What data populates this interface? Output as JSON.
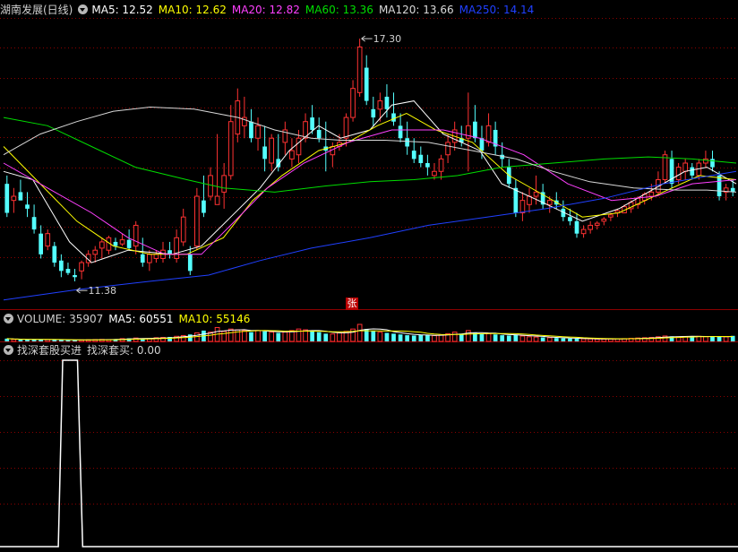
{
  "main_header": {
    "stock_name": "湖南发展(日线)",
    "ma_labels": [
      {
        "text": "MA5: 12.52",
        "color": "#ffffff"
      },
      {
        "text": "MA10: 12.62",
        "color": "#ffff00"
      },
      {
        "text": "MA20: 12.82",
        "color": "#ff40ff"
      },
      {
        "text": "MA60: 13.36",
        "color": "#00dd00"
      },
      {
        "text": "MA120: 13.66",
        "color": "#d8d8d8"
      },
      {
        "text": "MA250: 14.14",
        "color": "#2040ff"
      }
    ]
  },
  "volume_header": {
    "volume_label": "VOLUME: 35907",
    "ma5_label": "MA5: 60551",
    "ma10_label": "MA10: 55146"
  },
  "indicator_header": {
    "name": "找深套股买进",
    "value_label": "找深套买: 0.00"
  },
  "badge": "张",
  "chart_data": {
    "type": "candlestick",
    "price_range": [
      10.8,
      17.8
    ],
    "annotations": [
      {
        "text": "17.30",
        "value": 17.3
      },
      {
        "text": "11.38",
        "value": 11.38
      }
    ],
    "colors": {
      "up": "#ff3232",
      "down": "#54ffff",
      "ma5": "#ffffff",
      "ma10": "#ffff00",
      "ma20": "#ff40ff",
      "ma60": "#00dd00",
      "ma120": "#d8d8d8",
      "ma250": "#2040ff",
      "indicator": "#ffffff",
      "grid": "#8b0000"
    },
    "candles": [
      [
        13.8,
        14.0,
        13.0,
        13.1
      ],
      [
        13.4,
        13.7,
        13.1,
        13.5
      ],
      [
        13.6,
        13.9,
        13.4,
        13.4
      ],
      [
        13.3,
        13.6,
        13.0,
        13.2
      ],
      [
        13.0,
        13.3,
        12.6,
        12.7
      ],
      [
        12.6,
        12.8,
        12.0,
        12.1
      ],
      [
        12.3,
        12.7,
        12.2,
        12.6
      ],
      [
        12.3,
        12.4,
        11.8,
        11.9
      ],
      [
        11.95,
        12.1,
        11.55,
        11.7
      ],
      [
        11.75,
        11.9,
        11.6,
        11.65
      ],
      [
        11.6,
        11.75,
        11.45,
        11.55
      ],
      [
        11.7,
        11.95,
        11.5,
        11.9
      ],
      [
        11.9,
        12.2,
        11.8,
        12.1
      ],
      [
        12.1,
        12.3,
        11.9,
        12.2
      ],
      [
        12.25,
        12.5,
        12.0,
        12.4
      ],
      [
        12.2,
        12.55,
        12.1,
        12.5
      ],
      [
        12.4,
        12.5,
        12.2,
        12.3
      ],
      [
        12.35,
        12.6,
        12.3,
        12.45
      ],
      [
        12.45,
        12.7,
        12.2,
        12.25
      ],
      [
        12.3,
        12.9,
        12.1,
        12.8
      ],
      [
        12.1,
        12.5,
        11.8,
        11.9
      ],
      [
        11.9,
        12.2,
        11.7,
        12.1
      ],
      [
        12.0,
        12.2,
        11.9,
        12.1
      ],
      [
        12.0,
        12.4,
        11.9,
        12.2
      ],
      [
        12.2,
        12.4,
        12.0,
        12.1
      ],
      [
        12.0,
        12.7,
        11.9,
        12.5
      ],
      [
        12.4,
        13.2,
        12.3,
        13.0
      ],
      [
        12.1,
        12.3,
        11.6,
        11.7
      ],
      [
        12.3,
        13.7,
        12.2,
        13.5
      ],
      [
        13.4,
        14.0,
        13.0,
        13.1
      ],
      [
        13.5,
        14.2,
        13.4,
        14.0
      ],
      [
        13.3,
        15.0,
        13.3,
        13.5
      ],
      [
        13.6,
        14.3,
        13.2,
        14.0
      ],
      [
        14.0,
        15.7,
        13.9,
        15.3
      ],
      [
        15.0,
        16.1,
        14.8,
        15.8
      ],
      [
        15.2,
        15.9,
        14.9,
        15.4
      ],
      [
        15.3,
        15.6,
        14.8,
        14.9
      ],
      [
        14.9,
        15.4,
        14.6,
        15.2
      ],
      [
        14.7,
        15.2,
        14.1,
        14.4
      ],
      [
        14.3,
        15.0,
        14.1,
        14.9
      ],
      [
        14.4,
        15.0,
        14.1,
        14.2
      ],
      [
        14.8,
        15.3,
        14.5,
        15.1
      ],
      [
        14.4,
        14.9,
        14.2,
        14.6
      ],
      [
        14.5,
        15.1,
        14.3,
        14.9
      ],
      [
        14.9,
        15.5,
        14.8,
        15.3
      ],
      [
        15.4,
        15.7,
        15.0,
        15.1
      ],
      [
        15.1,
        15.4,
        14.8,
        14.9
      ],
      [
        14.7,
        15.3,
        14.1,
        14.6
      ],
      [
        14.5,
        14.8,
        14.2,
        14.7
      ],
      [
        14.7,
        15.0,
        14.6,
        14.8
      ],
      [
        14.9,
        15.5,
        14.7,
        15.4
      ],
      [
        15.4,
        16.3,
        15.3,
        16.1
      ],
      [
        16.0,
        17.3,
        15.9,
        17.1
      ],
      [
        16.6,
        16.9,
        15.7,
        15.8
      ],
      [
        15.6,
        15.9,
        15.2,
        15.4
      ],
      [
        15.6,
        16.0,
        15.3,
        15.8
      ],
      [
        15.9,
        16.2,
        15.4,
        15.6
      ],
      [
        15.5,
        16.0,
        15.2,
        15.3
      ],
      [
        15.2,
        15.5,
        14.8,
        14.9
      ],
      [
        14.9,
        15.3,
        14.5,
        14.7
      ],
      [
        14.6,
        14.9,
        14.3,
        14.4
      ],
      [
        14.5,
        14.7,
        14.2,
        14.3
      ],
      [
        14.3,
        14.5,
        14.0,
        14.2
      ],
      [
        14.0,
        14.3,
        13.9,
        14.1
      ],
      [
        14.1,
        14.5,
        13.9,
        14.4
      ],
      [
        14.5,
        15.0,
        14.3,
        14.8
      ],
      [
        14.8,
        15.3,
        14.6,
        15.1
      ],
      [
        14.9,
        15.2,
        14.7,
        14.8
      ],
      [
        14.9,
        16.0,
        14.1,
        15.2
      ],
      [
        15.3,
        15.7,
        14.8,
        14.9
      ],
      [
        14.9,
        15.2,
        14.4,
        14.6
      ],
      [
        14.8,
        15.5,
        14.7,
        15.2
      ],
      [
        15.1,
        15.3,
        14.5,
        14.7
      ],
      [
        14.5,
        14.8,
        14.2,
        14.4
      ],
      [
        14.2,
        14.4,
        13.7,
        13.8
      ],
      [
        13.7,
        13.9,
        13.0,
        13.1
      ],
      [
        13.1,
        13.6,
        12.9,
        13.4
      ],
      [
        13.3,
        13.7,
        13.1,
        13.5
      ],
      [
        13.5,
        14.0,
        13.3,
        13.6
      ],
      [
        13.6,
        13.8,
        13.2,
        13.3
      ],
      [
        13.3,
        13.5,
        13.1,
        13.4
      ],
      [
        13.4,
        13.6,
        13.2,
        13.3
      ],
      [
        13.2,
        13.4,
        12.9,
        13.0
      ],
      [
        13.0,
        13.2,
        12.8,
        12.9
      ],
      [
        12.9,
        13.1,
        12.5,
        12.6
      ],
      [
        12.6,
        12.8,
        12.5,
        12.7
      ],
      [
        12.7,
        12.9,
        12.6,
        12.8
      ],
      [
        12.8,
        12.9,
        12.7,
        12.85
      ],
      [
        12.9,
        13.0,
        12.8,
        12.95
      ],
      [
        13.0,
        13.1,
        12.9,
        13.05
      ],
      [
        13.1,
        13.2,
        13.0,
        13.15
      ],
      [
        13.1,
        13.3,
        13.1,
        13.25
      ],
      [
        13.2,
        13.4,
        13.1,
        13.35
      ],
      [
        13.3,
        13.5,
        13.2,
        13.45
      ],
      [
        13.4,
        13.6,
        13.3,
        13.55
      ],
      [
        13.5,
        13.8,
        13.4,
        13.6
      ],
      [
        13.6,
        14.1,
        13.5,
        13.9
      ],
      [
        13.9,
        14.6,
        13.8,
        14.5
      ],
      [
        14.4,
        14.6,
        13.7,
        13.8
      ],
      [
        13.9,
        14.3,
        13.8,
        14.2
      ],
      [
        14.1,
        14.4,
        13.9,
        14.3
      ],
      [
        14.2,
        14.3,
        13.9,
        14.0
      ],
      [
        14.0,
        14.4,
        13.9,
        14.3
      ],
      [
        14.3,
        14.6,
        14.2,
        14.4
      ],
      [
        14.4,
        14.6,
        14.1,
        14.2
      ],
      [
        14.0,
        14.1,
        13.4,
        13.5
      ],
      [
        13.6,
        13.8,
        13.4,
        13.7
      ],
      [
        13.7,
        13.9,
        13.5,
        13.6
      ]
    ],
    "ma": {
      "ma5": [
        [
          0,
          14.1
        ],
        [
          0.04,
          13.9
        ],
        [
          0.09,
          12.4
        ],
        [
          0.12,
          11.9
        ],
        [
          0.17,
          12.2
        ],
        [
          0.23,
          12.1
        ],
        [
          0.27,
          12.3
        ],
        [
          0.31,
          13.0
        ],
        [
          0.35,
          13.7
        ],
        [
          0.39,
          14.6
        ],
        [
          0.43,
          15.2
        ],
        [
          0.46,
          14.9
        ],
        [
          0.5,
          15.1
        ],
        [
          0.53,
          15.7
        ],
        [
          0.56,
          15.8
        ],
        [
          0.6,
          15.0
        ],
        [
          0.65,
          14.6
        ],
        [
          0.68,
          13.8
        ],
        [
          0.73,
          13.4
        ],
        [
          0.79,
          12.9
        ],
        [
          0.84,
          13.2
        ],
        [
          0.88,
          13.6
        ],
        [
          0.93,
          14.1
        ],
        [
          0.96,
          14.2
        ],
        [
          1,
          13.8
        ]
      ],
      "ma10": [
        [
          0,
          14.7
        ],
        [
          0.05,
          13.8
        ],
        [
          0.1,
          12.9
        ],
        [
          0.15,
          12.3
        ],
        [
          0.2,
          12.1
        ],
        [
          0.25,
          12.1
        ],
        [
          0.3,
          12.5
        ],
        [
          0.34,
          13.4
        ],
        [
          0.38,
          14.0
        ],
        [
          0.43,
          14.6
        ],
        [
          0.47,
          14.8
        ],
        [
          0.51,
          15.2
        ],
        [
          0.55,
          15.5
        ],
        [
          0.59,
          15.1
        ],
        [
          0.64,
          14.8
        ],
        [
          0.69,
          14.0
        ],
        [
          0.74,
          13.5
        ],
        [
          0.79,
          13.0
        ],
        [
          0.84,
          13.1
        ],
        [
          0.9,
          13.6
        ],
        [
          0.95,
          14.0
        ],
        [
          1,
          13.9
        ]
      ],
      "ma20": [
        [
          0,
          14.3
        ],
        [
          0.06,
          13.7
        ],
        [
          0.12,
          13.1
        ],
        [
          0.17,
          12.5
        ],
        [
          0.22,
          12.1
        ],
        [
          0.27,
          12.1
        ],
        [
          0.31,
          12.8
        ],
        [
          0.36,
          13.7
        ],
        [
          0.41,
          14.3
        ],
        [
          0.47,
          14.8
        ],
        [
          0.53,
          15.1
        ],
        [
          0.6,
          15.1
        ],
        [
          0.65,
          14.9
        ],
        [
          0.71,
          14.5
        ],
        [
          0.77,
          13.8
        ],
        [
          0.83,
          13.4
        ],
        [
          0.89,
          13.5
        ],
        [
          0.94,
          13.8
        ],
        [
          1,
          13.9
        ]
      ],
      "ma60": [
        [
          0,
          15.4
        ],
        [
          0.06,
          15.2
        ],
        [
          0.12,
          14.7
        ],
        [
          0.18,
          14.2
        ],
        [
          0.25,
          13.9
        ],
        [
          0.3,
          13.7
        ],
        [
          0.37,
          13.6
        ],
        [
          0.44,
          13.75
        ],
        [
          0.5,
          13.85
        ],
        [
          0.56,
          13.9
        ],
        [
          0.62,
          14.0
        ],
        [
          0.68,
          14.2
        ],
        [
          0.75,
          14.3
        ],
        [
          0.82,
          14.4
        ],
        [
          0.88,
          14.45
        ],
        [
          0.94,
          14.4
        ],
        [
          1,
          14.3
        ]
      ],
      "ma120": [
        [
          0,
          14.5
        ],
        [
          0.05,
          15.0
        ],
        [
          0.1,
          15.3
        ],
        [
          0.15,
          15.55
        ],
        [
          0.2,
          15.65
        ],
        [
          0.26,
          15.6
        ],
        [
          0.32,
          15.4
        ],
        [
          0.37,
          15.1
        ],
        [
          0.42,
          14.9
        ],
        [
          0.46,
          14.85
        ],
        [
          0.52,
          14.85
        ],
        [
          0.58,
          14.8
        ],
        [
          0.64,
          14.6
        ],
        [
          0.7,
          14.4
        ],
        [
          0.75,
          14.1
        ],
        [
          0.8,
          13.85
        ],
        [
          0.86,
          13.7
        ],
        [
          0.92,
          13.65
        ],
        [
          0.96,
          13.65
        ],
        [
          1,
          13.6
        ]
      ],
      "ma250": [
        [
          0,
          11.0
        ],
        [
          0.1,
          11.25
        ],
        [
          0.2,
          11.45
        ],
        [
          0.28,
          11.6
        ],
        [
          0.35,
          11.95
        ],
        [
          0.42,
          12.25
        ],
        [
          0.5,
          12.5
        ],
        [
          0.58,
          12.8
        ],
        [
          0.66,
          13.0
        ],
        [
          0.74,
          13.2
        ],
        [
          0.82,
          13.45
        ],
        [
          0.9,
          13.8
        ],
        [
          1,
          14.1
        ]
      ]
    },
    "volume": [
      18000,
      13000,
      12000,
      11000,
      12000,
      14000,
      11000,
      10000,
      9000,
      8000,
      9000,
      10000,
      11000,
      12000,
      13000,
      12000,
      15000,
      18000,
      20000,
      22000,
      20000,
      18000,
      24000,
      26000,
      29000,
      33000,
      38000,
      45000,
      55000,
      70000,
      60000,
      90000,
      65000,
      80000,
      75000,
      70000,
      60000,
      70000,
      65000,
      60000,
      55000,
      60000,
      70000,
      80000,
      75000,
      65000,
      60000,
      50000,
      48000,
      55000,
      65000,
      80000,
      110000,
      80000,
      70000,
      60000,
      55000,
      50000,
      45000,
      40000,
      38000,
      42000,
      40000,
      38000,
      42000,
      50000,
      60000,
      50000,
      70000,
      55000,
      48000,
      50000,
      45000,
      40000,
      38000,
      42000,
      35000,
      30000,
      28000,
      26000,
      24000,
      22000,
      20000,
      19000,
      18000,
      17000,
      16000,
      15000,
      15000,
      16000,
      17000,
      18000,
      20000,
      22000,
      24000,
      26000,
      30000,
      35000,
      33000,
      30000,
      32000,
      34000,
      33000,
      31000,
      30000,
      29000,
      30000,
      36000
    ],
    "indicator": [
      [
        0,
        0
      ],
      [
        0.079,
        0
      ],
      [
        0.085,
        1
      ],
      [
        0.105,
        1
      ],
      [
        0.112,
        0
      ],
      [
        1,
        0
      ]
    ]
  }
}
